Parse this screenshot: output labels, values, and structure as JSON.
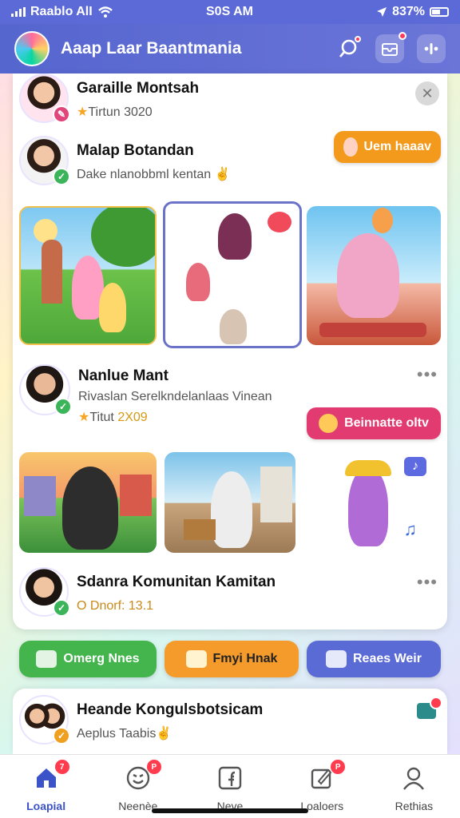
{
  "status_bar": {
    "carrier": "Raablo AlI",
    "time": "S0S AM",
    "battery": "837%"
  },
  "header": {
    "title": "Aaap Laar Baantmania"
  },
  "posts": [
    {
      "name": "Garaille Montsah",
      "subtitle": "Tirtun 3020",
      "check_color": "#e0457b"
    },
    {
      "name": "Malap Botandan",
      "subtitle": "Dake nlanobbml kentan",
      "action_label": "Uem haaav",
      "action_color": "#f39a1c",
      "check_color": "#3cb55a"
    },
    {
      "name": "Nanlue Mant",
      "subtitle": "Rivaslan Serelkndelanlaas Vinean",
      "meta": "Titut",
      "meta_value": "2X09",
      "action_label": "Beinnatte oltv",
      "action_color": "#e23b72",
      "check_color": "#3cb55a"
    },
    {
      "name": "Sdanra Komunitan Kamitan",
      "subtitle": "O Dnorf: 13.1",
      "check_color": "#3cb55a"
    }
  ],
  "chips": [
    {
      "label": "Omerg Nnes",
      "color": "#43b54c"
    },
    {
      "label": "Fmyi Hnak",
      "color": "#f49b2c"
    },
    {
      "label": "Reaes Weir",
      "color": "#5a6bd6"
    }
  ],
  "post_bottom": {
    "name": "Heande Kongulsbotsicam",
    "subtitle": "Aeplus Taabis",
    "check_color": "#f0a020"
  },
  "bottom_nav": [
    {
      "label": "Loapial",
      "badge": "7",
      "active": true
    },
    {
      "label": "Neenèe",
      "badge": "P"
    },
    {
      "label": "Neve",
      "badge": ""
    },
    {
      "label": "Loaloers",
      "badge": "P"
    },
    {
      "label": "Rethias",
      "badge": ""
    }
  ],
  "colors": {
    "primary": "#5b6ad6",
    "badge": "#ff3b4e"
  }
}
